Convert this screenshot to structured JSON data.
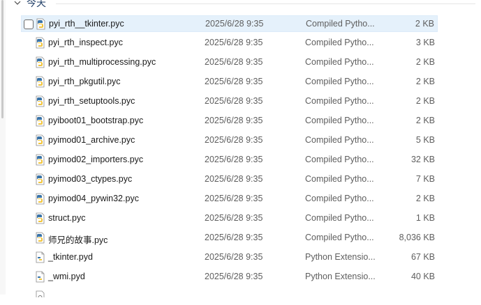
{
  "group": {
    "label": "今天"
  },
  "files": [
    {
      "name": "pyi_rth__tkinter.pyc",
      "date": "2025/6/28 9:35",
      "type": "Compiled Pytho...",
      "size": "2 KB",
      "icon": "python-compiled-icon"
    },
    {
      "name": "pyi_rth_inspect.pyc",
      "date": "2025/6/28 9:35",
      "type": "Compiled Pytho...",
      "size": "3 KB",
      "icon": "python-compiled-icon"
    },
    {
      "name": "pyi_rth_multiprocessing.pyc",
      "date": "2025/6/28 9:35",
      "type": "Compiled Pytho...",
      "size": "2 KB",
      "icon": "python-compiled-icon"
    },
    {
      "name": "pyi_rth_pkgutil.pyc",
      "date": "2025/6/28 9:35",
      "type": "Compiled Pytho...",
      "size": "2 KB",
      "icon": "python-compiled-icon"
    },
    {
      "name": "pyi_rth_setuptools.pyc",
      "date": "2025/6/28 9:35",
      "type": "Compiled Pytho...",
      "size": "2 KB",
      "icon": "python-compiled-icon"
    },
    {
      "name": "pyiboot01_bootstrap.pyc",
      "date": "2025/6/28 9:35",
      "type": "Compiled Pytho...",
      "size": "2 KB",
      "icon": "python-compiled-icon"
    },
    {
      "name": "pyimod01_archive.pyc",
      "date": "2025/6/28 9:35",
      "type": "Compiled Pytho...",
      "size": "5 KB",
      "icon": "python-compiled-icon"
    },
    {
      "name": "pyimod02_importers.pyc",
      "date": "2025/6/28 9:35",
      "type": "Compiled Pytho...",
      "size": "32 KB",
      "icon": "python-compiled-icon"
    },
    {
      "name": "pyimod03_ctypes.pyc",
      "date": "2025/6/28 9:35",
      "type": "Compiled Pytho...",
      "size": "7 KB",
      "icon": "python-compiled-icon"
    },
    {
      "name": "pyimod04_pywin32.pyc",
      "date": "2025/6/28 9:35",
      "type": "Compiled Pytho...",
      "size": "2 KB",
      "icon": "python-compiled-icon"
    },
    {
      "name": "struct.pyc",
      "date": "2025/6/28 9:35",
      "type": "Compiled Pytho...",
      "size": "1 KB",
      "icon": "python-compiled-icon"
    },
    {
      "name": "师兄的故事.pyc",
      "date": "2025/6/28 9:35",
      "type": "Compiled Pytho...",
      "size": "8,036 KB",
      "icon": "python-compiled-icon"
    },
    {
      "name": "_tkinter.pyd",
      "date": "2025/6/28 9:35",
      "type": "Python Extensio...",
      "size": "67 KB",
      "icon": "python-extension-icon"
    },
    {
      "name": "_wmi.pyd",
      "date": "2025/6/28 9:35",
      "type": "Python Extensio...",
      "size": "40 KB",
      "icon": "python-extension-icon"
    },
    {
      "name": "",
      "date": "",
      "type": "",
      "size": "",
      "icon": "dll-file-icon"
    }
  ]
}
